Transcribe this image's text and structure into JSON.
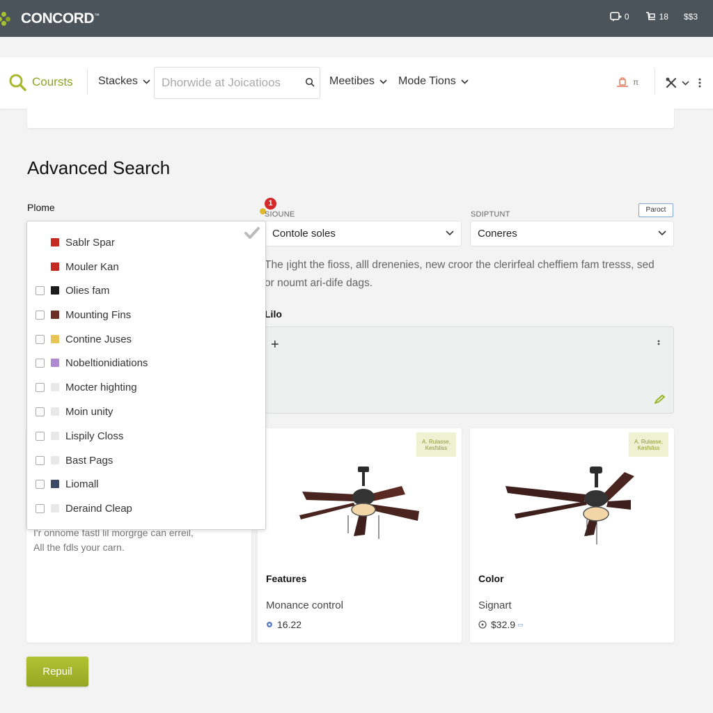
{
  "topbar": {
    "brand": "CONCORD",
    "brand_mark": "™",
    "items": [
      {
        "icon": "chat-icon",
        "label": "0"
      },
      {
        "icon": "cart-icon",
        "label": "18"
      },
      {
        "icon": "currency-icon",
        "label": "$$3"
      }
    ]
  },
  "nav": {
    "courses": "Coursts",
    "stacks": "Stackes",
    "search_placeholder": "Dhorwide at Joicatioos",
    "meetibes": "Meetibes",
    "mode_tions": "Mode Tions",
    "cart_label": "π"
  },
  "page": {
    "title": "Advanced Search"
  },
  "filters": {
    "label": "Plome",
    "items": [
      {
        "label": "Sablr Spar",
        "color": "#c42b22",
        "checkbox": false
      },
      {
        "label": "Mouler Kan",
        "color": "#c42b22",
        "checkbox": false
      },
      {
        "label": "Olies fam",
        "color": "#1c1c1c",
        "checkbox": true
      },
      {
        "label": "Mounting Fins",
        "color": "#6b2f26",
        "checkbox": true
      },
      {
        "label": "Contine Juses",
        "color": "#e9c558",
        "checkbox": true
      },
      {
        "label": "Nobeltionidiations",
        "color": "#b08ad0",
        "checkbox": true
      },
      {
        "label": "Mocter highting",
        "color": "#e8e8e8",
        "checkbox": true
      },
      {
        "label": "Moin unity",
        "color": "#e8e8e8",
        "checkbox": true
      },
      {
        "label": "Lispily Closs",
        "color": "#e8e8e8",
        "checkbox": true
      },
      {
        "label": "Bast Pags",
        "color": "#e8e8e8",
        "checkbox": true
      },
      {
        "label": "Liomall",
        "color": "#3d4a66",
        "checkbox": true
      },
      {
        "label": "Deraind Cleap",
        "color": "#e8e8e8",
        "checkbox": true
      }
    ]
  },
  "selects": {
    "first_label": "SIOUNE",
    "first_badge": "1",
    "first_value": "Contole soles",
    "second_label": "SDIPTUNT",
    "second_value": "Coneres",
    "reset": "Paroct"
  },
  "description": "The ꞁight the fioss, alll drenenies, new croor the clerirfeal cheffiem fam tresss, sed or noumt ari-dife dags.",
  "lilo": {
    "label": "Lilo",
    "plus": "+"
  },
  "cards": {
    "left": {
      "line1": "I'r onnome fastl lil morgrge can erreil,",
      "line2": "All the fdls your carn."
    },
    "middle": {
      "tag": "A. Rulasse, Kesfsliss",
      "heading": "Features",
      "sub": "Monance control",
      "value": "16.22",
      "icon": "disc-icon"
    },
    "right": {
      "tag": "A. Rulasse, Kesfsliss",
      "heading": "Color",
      "sub": "Signart",
      "value": "$32.9",
      "value_suffix": "▭",
      "icon": "coin-icon"
    }
  },
  "actions": {
    "primary": "Repuil"
  },
  "colors": {
    "topbar_bg": "#4b535b",
    "accent": "#a7b82e",
    "badge_red": "#d32929"
  }
}
